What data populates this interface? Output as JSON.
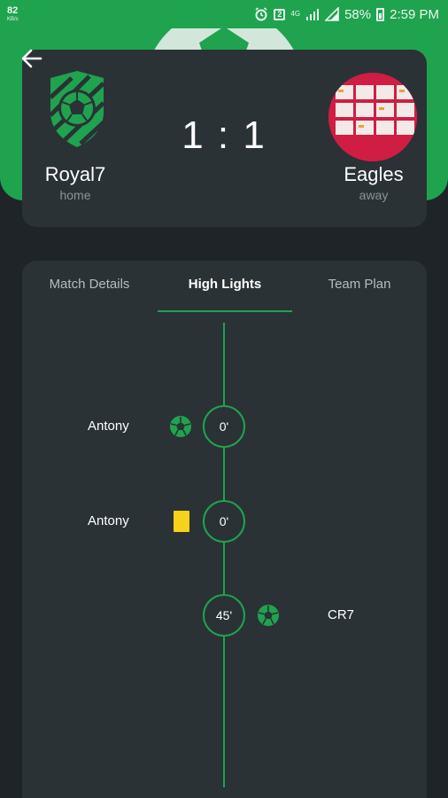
{
  "status_bar": {
    "signal_text": "82",
    "signal_sub": "KB/s",
    "network": "4G",
    "battery": "58%",
    "time": "2:59 PM"
  },
  "match": {
    "home": {
      "name": "Royal7",
      "side": "home"
    },
    "away": {
      "name": "Eagles",
      "side": "away"
    },
    "score": "1 : 1"
  },
  "tabs": [
    {
      "label": "Match Details",
      "active": false
    },
    {
      "label": "High Lights",
      "active": true
    },
    {
      "label": "Team Plan",
      "active": false
    }
  ],
  "events": [
    {
      "minute": "0'",
      "player": "Antony",
      "team": "home",
      "type": "goal"
    },
    {
      "minute": "0'",
      "player": "Antony",
      "team": "home",
      "type": "yellow-card"
    },
    {
      "minute": "45'",
      "player": "CR7",
      "team": "away",
      "type": "goal"
    }
  ],
  "colors": {
    "accent": "#1fa34f",
    "background": "#1e2428",
    "card": "#2a3236",
    "yellow_card": "#f6d21b"
  },
  "icons": {
    "back": "arrow-left-icon",
    "goal": "soccer-ball-icon",
    "booking": "yellow-card-icon"
  }
}
